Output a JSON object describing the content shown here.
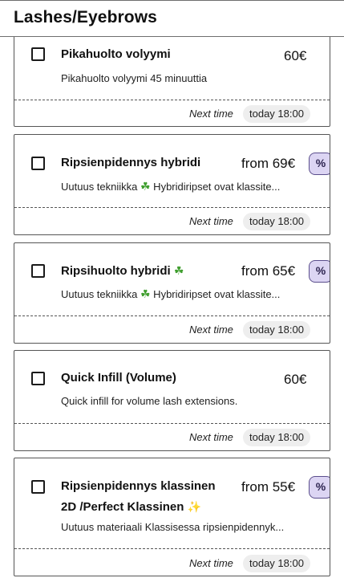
{
  "header": {
    "title": "Lashes/Eyebrows"
  },
  "cards": [
    {
      "title": "Pikahuolto volyymi",
      "price": "60€",
      "description": "Pikahuolto volyymi 45 minuuttia",
      "next_label": "Next time",
      "next_time": "today 18:00"
    },
    {
      "title": "Ripsienpidennys hybridi",
      "price": "from 69€",
      "badge": "%",
      "description_pre": "Uutuus tekniikka ",
      "description_post": " Hybridiripset ovat klassite...",
      "next_label": "Next time",
      "next_time": "today 18:00"
    },
    {
      "title": "Ripsihuolto hybridi",
      "price": "from 65€",
      "badge": "%",
      "description_pre": "Uutuus tekniikka ",
      "description_post": " Hybridiripset ovat klassite...",
      "next_label": "Next time",
      "next_time": "today 18:00"
    },
    {
      "title": "Quick Infill (Volume)",
      "price": "60€",
      "description": "Quick infill for volume lash extensions.",
      "next_label": "Next time",
      "next_time": "today 18:00"
    },
    {
      "title_line1": "Ripsienpidennys klassinen",
      "title_line2": "2D /Perfect Klassinen",
      "price": "from 55€",
      "badge": "%",
      "description": "Uutuus materiaali Klassisessa ripsienpidennyk...",
      "next_label": "Next time",
      "next_time": "today 18:00"
    }
  ],
  "icons": {
    "clover": "shamrock-emoji",
    "sparkle": "sparkles-emoji"
  },
  "colors": {
    "badge_bg": "#dcd5f3",
    "badge_border": "#5b4e8c",
    "pill_bg": "#eeeeee"
  }
}
